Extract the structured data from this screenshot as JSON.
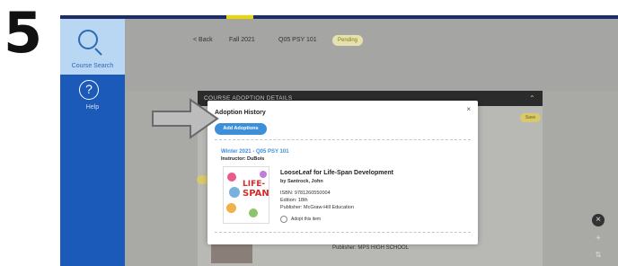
{
  "step_number": "5",
  "sidebar": {
    "items": [
      {
        "label": "Course Search",
        "icon": "search-icon",
        "active": true
      },
      {
        "label": "Help",
        "icon": "help-icon",
        "active": false
      }
    ]
  },
  "breadcrumb": {
    "back": "< Back",
    "term": "Fall 2021",
    "course": "Q05 PSY 101",
    "status_pill": "Pending"
  },
  "details": {
    "header": "COURSE ADOPTION DETAILS",
    "pill": "Save",
    "publisher_bg": "Publisher: MPS HIGH SCHOOL"
  },
  "modal": {
    "title": "Adoption History",
    "close": "×",
    "add_button": "Add Adoptions",
    "term": "Winter 2021 - Q05 PSY 101",
    "instructor": "Instructor: DuBois",
    "book": {
      "cover_word_1": "LIFE-",
      "cover_word_2": "SPAN",
      "title": "LooseLeaf for Life-Span Development",
      "author": "by Santrock, John",
      "isbn": "ISBN: 9781260550004",
      "edition": "Edition: 18th",
      "publisher": "Publisher: McGraw-Hill Education",
      "adopt_label": "Adopt this item"
    }
  },
  "colors": {
    "sidebar": "#1b5ab8",
    "accent_blue": "#3d8fd9",
    "arrow_fill": "#bcbcbc"
  }
}
